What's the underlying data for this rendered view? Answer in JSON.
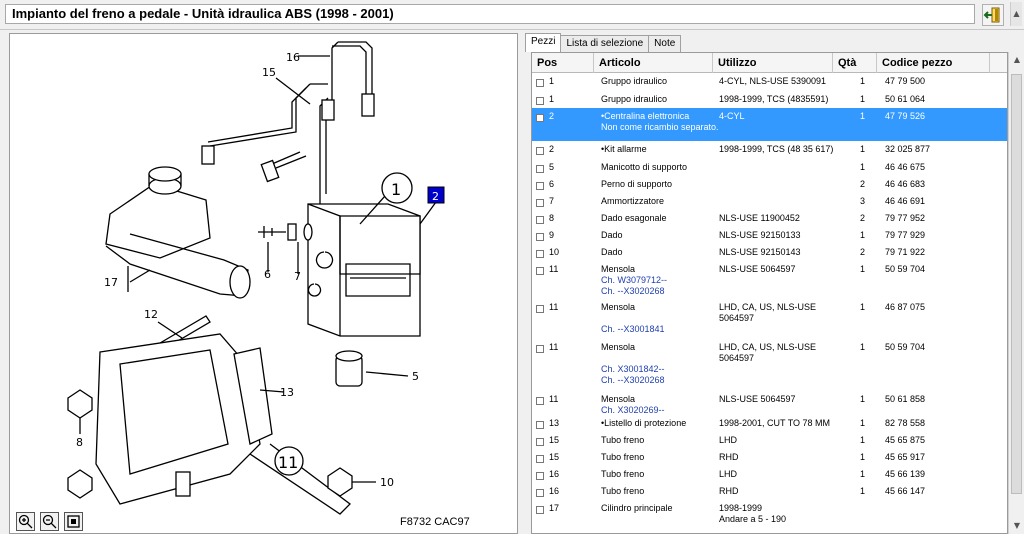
{
  "window": {
    "title": "Impianto del freno a pedale - Unità idraulica ABS   (1998 - 2001)"
  },
  "diagram": {
    "code": "F8732 CAC97",
    "callouts": [
      "16",
      "15",
      "1",
      "2",
      "17",
      "6",
      "7",
      "12",
      "5",
      "13",
      "8",
      "11",
      "10"
    ],
    "selected_callout": "2",
    "zoom_buttons": [
      "zoom-in",
      "zoom-out",
      "zoom-fit"
    ]
  },
  "tabs": [
    {
      "label": "Pezzi",
      "active": true
    },
    {
      "label": "Lista di selezione",
      "active": false
    },
    {
      "label": "Note",
      "active": false
    }
  ],
  "table": {
    "headers": {
      "pos": "Pos",
      "articolo": "Articolo",
      "utilizzo": "Utilizzo",
      "qta": "Qtà",
      "codice": "Codice pezzo"
    },
    "rows": [
      {
        "pos": "1",
        "articolo": "Gruppo idraulico",
        "utilizzo": "4-CYL, NLS-USE 5390091",
        "qta": "1",
        "codice": "47 79 500"
      },
      {
        "pos": "1",
        "articolo": "Gruppo idraulico",
        "utilizzo": "1998-1999, TCS (4835591)",
        "qta": "1",
        "codice": "50 61 064"
      },
      {
        "pos": "2",
        "articolo": "•Centralina elettronica",
        "extra": "Non come ricambio separato.",
        "utilizzo": "4-CYL",
        "qta": "1",
        "codice": "47 79 526",
        "selected": true
      },
      {
        "pos": "2",
        "articolo": "•Kit allarme",
        "utilizzo": "1998-1999, TCS (48 35 617)",
        "qta": "1",
        "codice": "32 025 877"
      },
      {
        "pos": "5",
        "articolo": "Manicotto di supporto",
        "utilizzo": "",
        "qta": "1",
        "codice": "46 46 675"
      },
      {
        "pos": "6",
        "articolo": "Perno di supporto",
        "utilizzo": "",
        "qta": "2",
        "codice": "46 46 683"
      },
      {
        "pos": "7",
        "articolo": "Ammortizzatore",
        "utilizzo": "",
        "qta": "3",
        "codice": "46 46 691"
      },
      {
        "pos": "8",
        "articolo": "Dado esagonale",
        "utilizzo": "NLS-USE 11900452",
        "qta": "2",
        "codice": "79 77 952"
      },
      {
        "pos": "9",
        "articolo": "Dado",
        "utilizzo": "NLS-USE 92150133",
        "qta": "1",
        "codice": "79 77 929"
      },
      {
        "pos": "10",
        "articolo": "Dado",
        "utilizzo": "NLS-USE 92150143",
        "qta": "2",
        "codice": "79 71 922"
      },
      {
        "pos": "11",
        "articolo": "Mensola",
        "blue": [
          "Ch. W3079712--",
          "Ch. --X3020268"
        ],
        "utilizzo": "NLS-USE 5064597",
        "qta": "1",
        "codice": "50 59 704"
      },
      {
        "pos": "11",
        "articolo": "Mensola",
        "blue": [
          "",
          "Ch. --X3001841"
        ],
        "utilizzo": "LHD, CA, US, NLS-USE 5064597",
        "qta": "1",
        "codice": "46 87 075"
      },
      {
        "pos": "11",
        "articolo": "Mensola",
        "blue": [
          "",
          "Ch. X3001842--",
          "Ch. --X3020268"
        ],
        "utilizzo": "LHD, CA, US, NLS-USE 5064597",
        "qta": "1",
        "codice": "50 59 704"
      },
      {
        "pos": "11",
        "articolo": "Mensola",
        "blue": [
          "Ch. X3020269--"
        ],
        "utilizzo": "NLS-USE 5064597",
        "qta": "1",
        "codice": "50 61 858"
      },
      {
        "pos": "13",
        "articolo": "•Listello di protezione",
        "utilizzo": "1998-2001, CUT TO 78 MM",
        "qta": "1",
        "codice": "82 78 558"
      },
      {
        "pos": "15",
        "articolo": "Tubo freno",
        "utilizzo": "LHD",
        "qta": "1",
        "codice": "45 65 875"
      },
      {
        "pos": "15",
        "articolo": "Tubo freno",
        "utilizzo": "RHD",
        "qta": "1",
        "codice": "45 65 917"
      },
      {
        "pos": "16",
        "articolo": "Tubo freno",
        "utilizzo": "LHD",
        "qta": "1",
        "codice": "45 66 139"
      },
      {
        "pos": "16",
        "articolo": "Tubo freno",
        "utilizzo": "RHD",
        "qta": "1",
        "codice": "45 66 147"
      },
      {
        "pos": "17",
        "articolo": "Cilindro principale",
        "utilizzo": "1998-1999\nAndare a 5 - 190",
        "qta": "",
        "codice": ""
      }
    ]
  }
}
